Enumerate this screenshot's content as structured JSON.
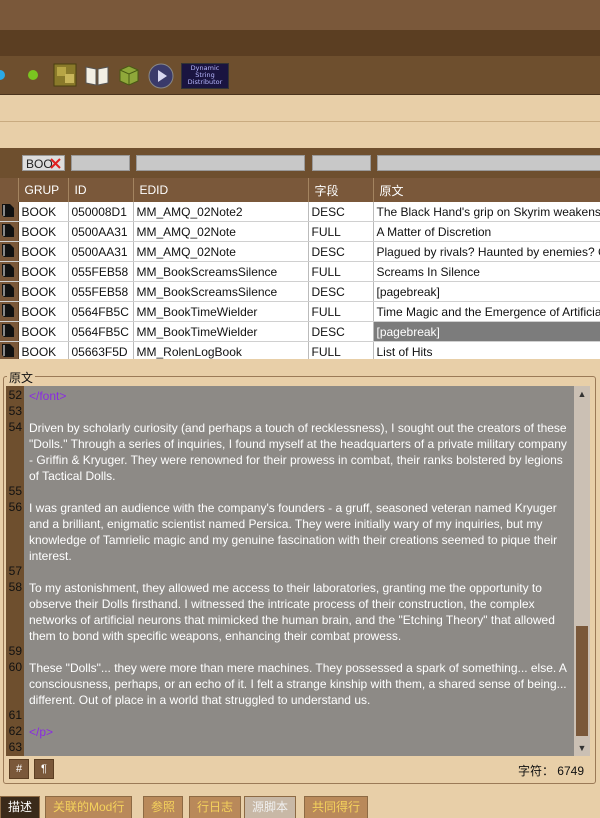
{
  "toolbar": {
    "icons": [
      "blue-dot-icon",
      "green-dot-icon",
      "esp-plugin-icon",
      "book-icon",
      "package-icon",
      "play-icon",
      "dsd-logo-icon"
    ],
    "dsd_label": [
      "Dynamic",
      "String",
      "Distributor"
    ]
  },
  "filter": {
    "grup_value": "BOO"
  },
  "table": {
    "columns": [
      "GRUP",
      "ID",
      "EDID",
      "字段",
      "原文"
    ],
    "rows": [
      {
        "grup": "BOOK",
        "id": "050008D1",
        "edid": "MM_AMQ_02Note2",
        "field": "DESC",
        "text": "The Black Hand's grip on Skyrim weakens."
      },
      {
        "grup": "BOOK",
        "id": "0500AA31",
        "edid": "MM_AMQ_02Note",
        "field": "FULL",
        "text": "A Matter of Discretion"
      },
      {
        "grup": "BOOK",
        "id": "0500AA31",
        "edid": "MM_AMQ_02Note",
        "field": "DESC",
        "text": "Plagued by rivals? Haunted by enemies? C"
      },
      {
        "grup": "BOOK",
        "id": "055FEB58",
        "edid": "MM_BookScreamsSilence",
        "field": "FULL",
        "text": "Screams In Silence"
      },
      {
        "grup": "BOOK",
        "id": "055FEB58",
        "edid": "MM_BookScreamsSilence",
        "field": "DESC",
        "text": "[pagebreak]"
      },
      {
        "grup": "BOOK",
        "id": "0564FB5C",
        "edid": "MM_BookTimeWielder",
        "field": "FULL",
        "text": "Time Magic and the Emergence of Artificia"
      },
      {
        "grup": "BOOK",
        "id": "0564FB5C",
        "edid": "MM_BookTimeWielder",
        "field": "DESC",
        "text": "[pagebreak]"
      },
      {
        "grup": "BOOK",
        "id": "05663F5D",
        "edid": "MM_RolenLogBook",
        "field": "FULL",
        "text": "List of Hits"
      }
    ]
  },
  "editor": {
    "group_label": "原文",
    "lines": [
      {
        "n": "52",
        "t": "</font>",
        "tag": true
      },
      {
        "n": "53",
        "t": ""
      },
      {
        "n": "54",
        "t": "Driven by scholarly curiosity (and perhaps a touch of recklessness), I sought out the creators of these \"Dolls.\" Through a series of inquiries, I found myself at the headquarters of a private military company - Griffin & Kryuger. They were renowned for their prowess in combat, their ranks bolstered by legions of Tactical Dolls."
      },
      {
        "n": "55",
        "t": ""
      },
      {
        "n": "56",
        "t": "I was granted an audience with the company's founders - a gruff, seasoned veteran named Kryuger and a brilliant, enigmatic scientist named Persica. They were initially wary of my inquiries, but my knowledge of Tamrielic magic and my genuine fascination with their creations seemed to pique their interest."
      },
      {
        "n": "57",
        "t": ""
      },
      {
        "n": "58",
        "t": "To my astonishment, they allowed me access to their laboratories, granting me the opportunity to observe their Dolls firsthand. I witnessed the intricate process of their construction, the complex networks of artificial neurons that mimicked the human brain, and the \"Etching Theory\" that allowed them to bond with specific weapons, enhancing their combat prowess."
      },
      {
        "n": "59",
        "t": ""
      },
      {
        "n": "60",
        "t": "These \"Dolls\"... they were more than mere machines. They possessed a spark of something... else. A consciousness, perhaps, or an echo of it. I felt a strange kinship with them, a shared sense of being... different. Out of place in a world that struggled to understand us."
      },
      {
        "n": "61",
        "t": ""
      },
      {
        "n": "62",
        "t": "</p>",
        "tag": true
      },
      {
        "n": "63",
        "t": ""
      }
    ],
    "btn_hash": "#",
    "btn_para": "¶",
    "char_count_label": "字符：",
    "char_count_value": "6749"
  },
  "tabs": [
    {
      "label": "描述",
      "state": "active"
    },
    {
      "label": "关联的Mod行",
      "state": "normal"
    },
    {
      "label": "参照",
      "state": "normal"
    },
    {
      "label": "行日志",
      "state": "normal"
    },
    {
      "label": "源脚本",
      "state": "dim"
    },
    {
      "label": "共同得行",
      "state": "normal"
    }
  ],
  "colors": {
    "brown_dark": "#5b3e22",
    "brown": "#7a583a",
    "tan": "#e8cfa8",
    "editor_bg": "#8d8a86",
    "tab_text": "#f5d25c"
  }
}
